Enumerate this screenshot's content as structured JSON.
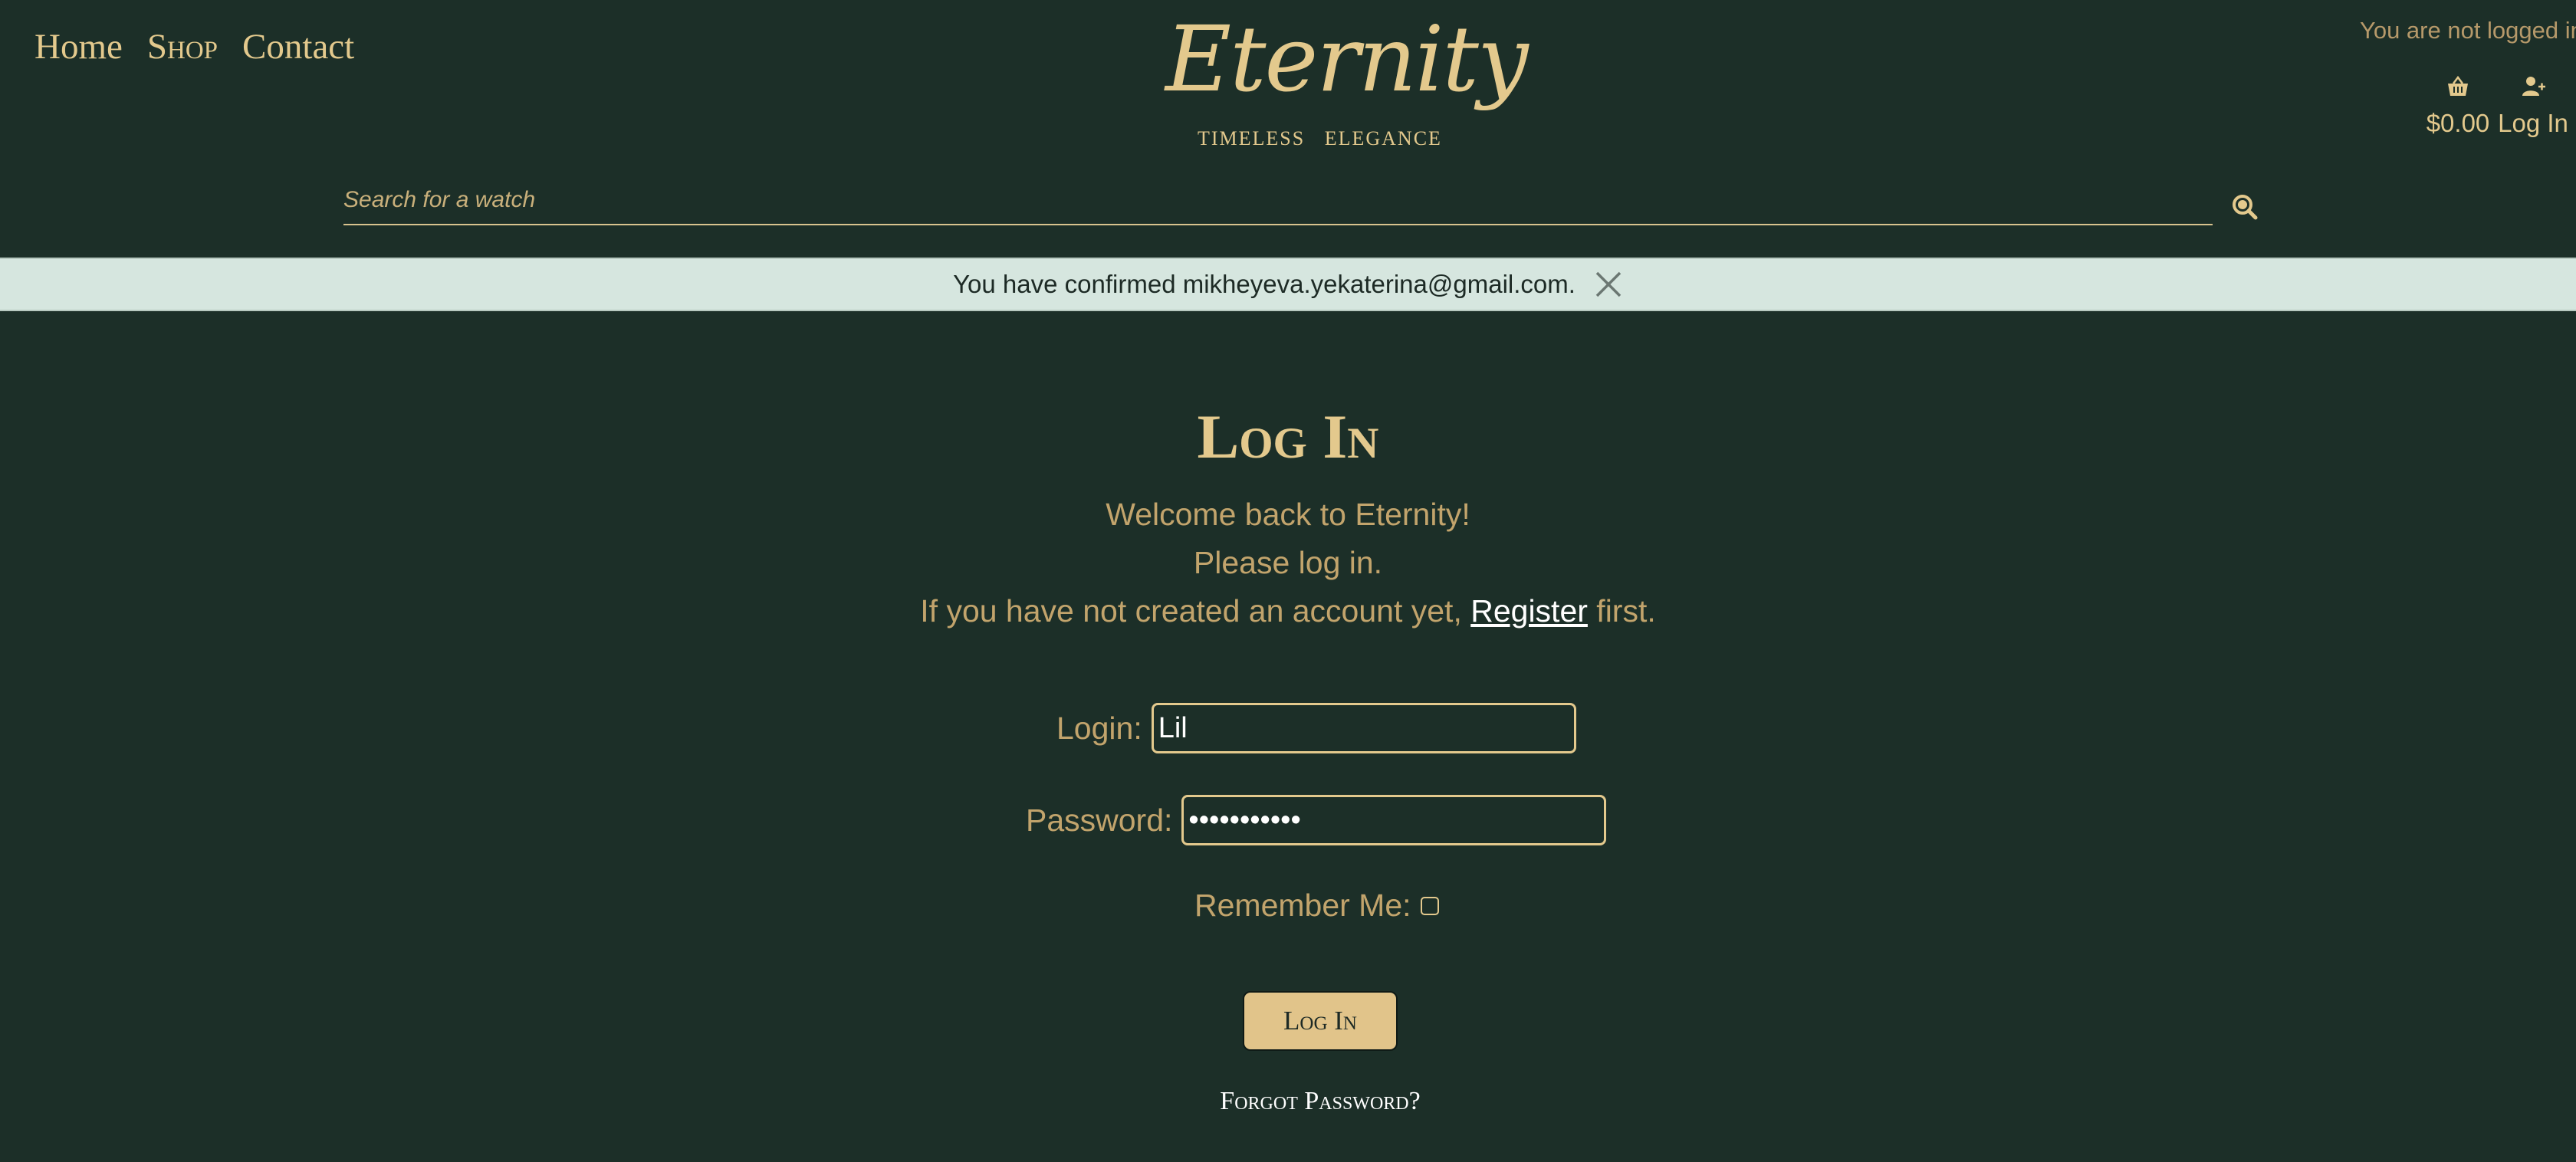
{
  "nav": {
    "items": [
      {
        "label": "Home"
      },
      {
        "label": "Shop"
      },
      {
        "label": "Contact"
      }
    ]
  },
  "brand": {
    "logo_text": "Eternity",
    "tagline": "TIMELESS   ELEGANCE"
  },
  "header": {
    "login_status": "You are not logged in",
    "cart_total": "$0.00",
    "cart_icon": "shopping-basket-icon",
    "account_label": "Log In",
    "account_icon": "user-add-icon"
  },
  "search": {
    "placeholder": "Search for a watch",
    "value": "",
    "icon": "search-icon"
  },
  "message": {
    "text": "You have confirmed mikheyeva.yekaterina@gmail.com.",
    "close_icon": "close-icon"
  },
  "login": {
    "title": "Log In",
    "intro_line1": "Welcome back to Eternity!",
    "intro_line2": "Please log in.",
    "intro_line3_before": "If you have not created an account yet, ",
    "register_link": "Register",
    "intro_line3_after": " first.",
    "login_label": "Login:",
    "login_value": "Lil",
    "password_label": "Password:",
    "password_value": "•••••••••••",
    "remember_label": "Remember Me:",
    "remember_checked": false,
    "submit_label": "Log In",
    "forgot_link": "Forgot Password?"
  },
  "colors": {
    "background": "#1c2f28",
    "gold": "#e3c98d",
    "muted_gold": "#c2a46c",
    "banner_bg": "#d6e6df",
    "button_bg": "#e1c48a"
  }
}
